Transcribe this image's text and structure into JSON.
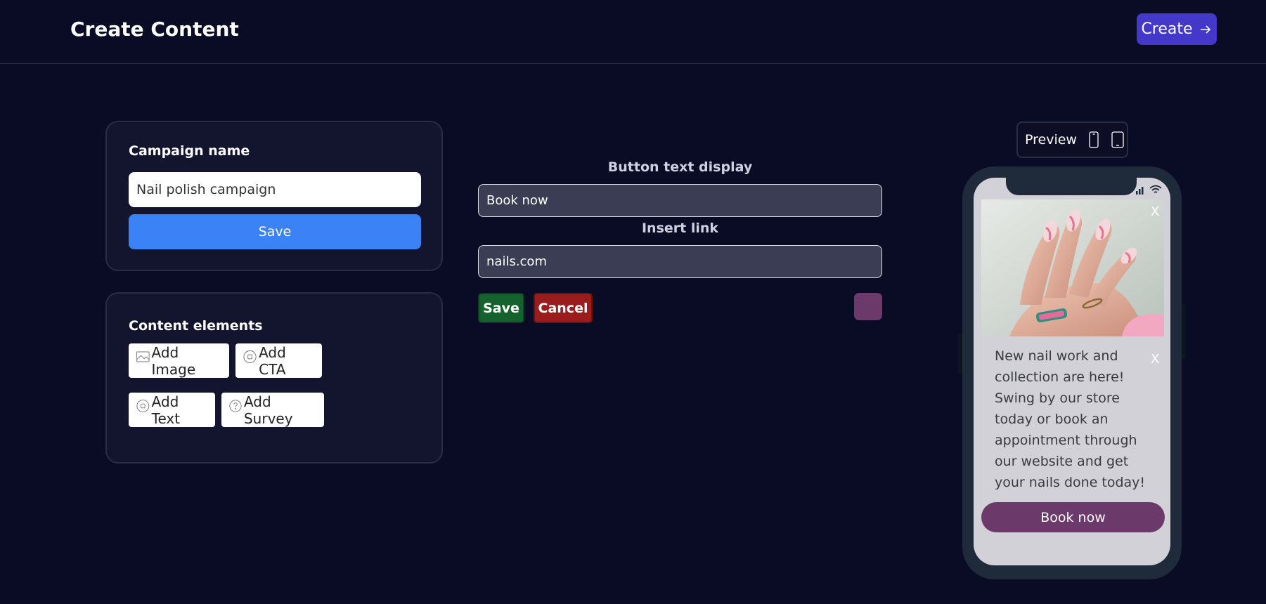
{
  "header": {
    "title": "Create Content",
    "create_label": "Create"
  },
  "campaign": {
    "label": "Campaign name",
    "name_value": "Nail polish campaign",
    "save_label": "Save"
  },
  "elements": {
    "label": "Content elements",
    "buttons": [
      {
        "label": "Add Image",
        "icon": "image-icon"
      },
      {
        "label": "Add CTA",
        "icon": "cta-icon"
      },
      {
        "label": "Add Text",
        "icon": "text-icon"
      },
      {
        "label": "Add Survey",
        "icon": "survey-icon"
      }
    ]
  },
  "editor": {
    "button_text_label": "Button text display",
    "button_text_value": "Book now",
    "link_label": "Insert link",
    "link_value": "nails.com",
    "save_label": "Save",
    "cancel_label": "Cancel",
    "swatch_color": "#6b3a6b"
  },
  "preview": {
    "label": "Preview",
    "close_label": "X",
    "message": "New nail work and collection are here! Swing by our store today or book an appointment through our website and get your nails done today!",
    "cta_label": "Book now",
    "cta_color": "#6b3a6b"
  },
  "colors": {
    "background": "#0a0b24",
    "accent": "#4338ca",
    "save_blue": "#3b82f6",
    "save_green": "#15622f",
    "cancel_red": "#9b1c1c"
  }
}
